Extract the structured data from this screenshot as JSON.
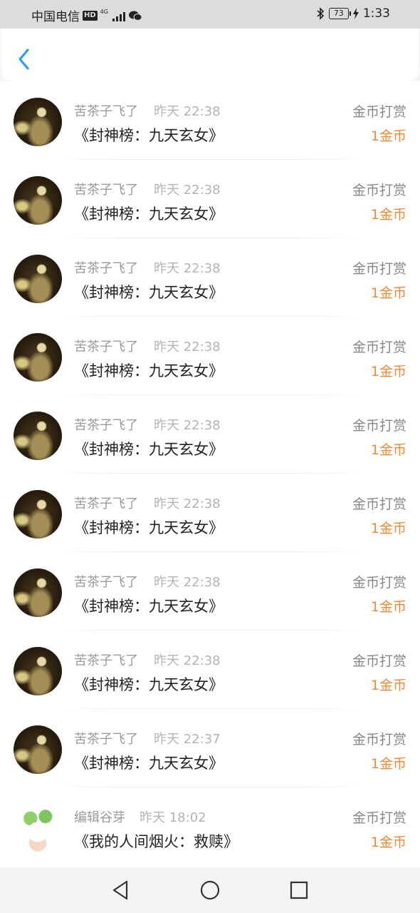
{
  "status_bar": {
    "carrier": "中国电信",
    "hd_badge": "HD",
    "network_type": "4G",
    "battery_level": "73",
    "time": "1:33"
  },
  "header": {
    "back_icon": "chevron-left-icon",
    "accent_color": "#2a9ee8"
  },
  "records": [
    {
      "name": "苦茶子飞了",
      "time": "昨天 22:38",
      "title": "《封神榜：九天玄女》",
      "type": "金币打赏",
      "amount": "1金币"
    },
    {
      "name": "苦茶子飞了",
      "time": "昨天 22:38",
      "title": "《封神榜：九天玄女》",
      "type": "金币打赏",
      "amount": "1金币"
    },
    {
      "name": "苦茶子飞了",
      "time": "昨天 22:38",
      "title": "《封神榜：九天玄女》",
      "type": "金币打赏",
      "amount": "1金币"
    },
    {
      "name": "苦茶子飞了",
      "time": "昨天 22:38",
      "title": "《封神榜：九天玄女》",
      "type": "金币打赏",
      "amount": "1金币"
    },
    {
      "name": "苦茶子飞了",
      "time": "昨天 22:38",
      "title": "《封神榜：九天玄女》",
      "type": "金币打赏",
      "amount": "1金币"
    },
    {
      "name": "苦茶子飞了",
      "time": "昨天 22:38",
      "title": "《封神榜：九天玄女》",
      "type": "金币打赏",
      "amount": "1金币"
    },
    {
      "name": "苦茶子飞了",
      "time": "昨天 22:38",
      "title": "《封神榜：九天玄女》",
      "type": "金币打赏",
      "amount": "1金币"
    },
    {
      "name": "苦茶子飞了",
      "time": "昨天 22:38",
      "title": "《封神榜：九天玄女》",
      "type": "金币打赏",
      "amount": "1金币"
    },
    {
      "name": "苦茶子飞了",
      "time": "昨天 22:37",
      "title": "《封神榜：九天玄女》",
      "type": "金币打赏",
      "amount": "1金币"
    },
    {
      "name": "编辑谷芽",
      "time": "昨天 18:02",
      "title": "《我的人间烟火：救赎》",
      "type": "金币打赏",
      "amount": "1金币"
    }
  ],
  "amount_color": "#ee8a36",
  "nav_bar": {
    "icons": [
      "back-triangle-icon",
      "home-circle-icon",
      "recents-square-icon"
    ]
  }
}
